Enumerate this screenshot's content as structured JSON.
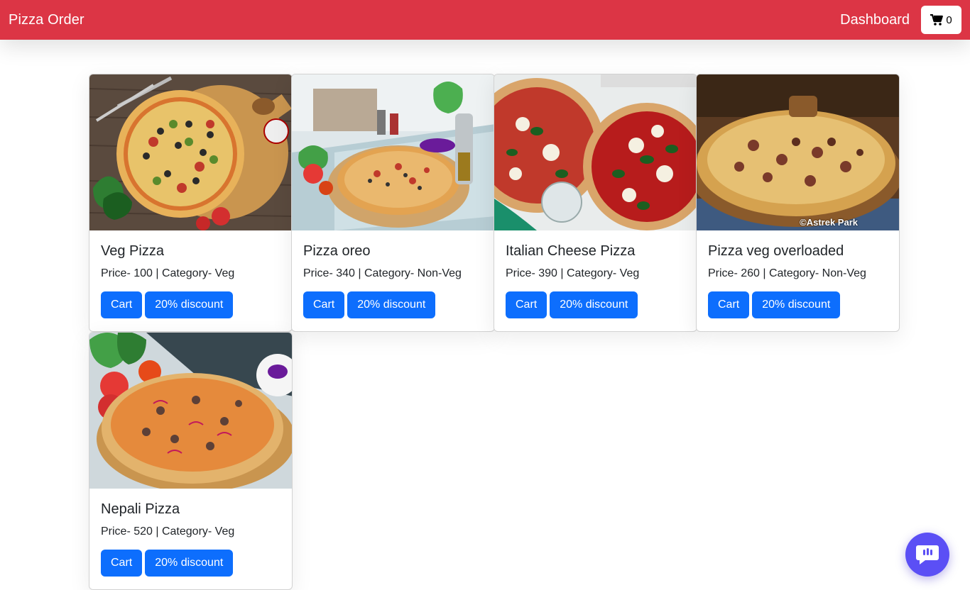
{
  "nav": {
    "brand": "Pizza Order",
    "dashboard": "Dashboard",
    "cart_count": "0",
    "cart_icon": "shopping-cart-icon",
    "bg_color": "#dc3545"
  },
  "products": [
    {
      "name": "Veg Pizza",
      "meta": "Price- 100 | Category- Veg",
      "cart_label": "Cart",
      "discount_label": "20% discount"
    },
    {
      "name": "Pizza oreo",
      "meta": "Price- 340 | Category- Non-Veg",
      "cart_label": "Cart",
      "discount_label": "20% discount"
    },
    {
      "name": "Italian Cheese Pizza",
      "meta": "Price- 390 | Category- Veg",
      "cart_label": "Cart",
      "discount_label": "20% discount"
    },
    {
      "name": "Pizza veg overloaded",
      "meta": "Price- 260 | Category- Non-Veg",
      "cart_label": "Cart",
      "discount_label": "20% discount",
      "watermark": "©Astrek Park"
    },
    {
      "name": "Nepali Pizza",
      "meta": "Price- 520 | Category- Veg",
      "cart_label": "Cart",
      "discount_label": "20% discount"
    }
  ],
  "colors": {
    "primary_button": "#0d6efd",
    "chat_button": "#5b4ff5"
  },
  "chat": {
    "icon": "chat-bubble-icon"
  }
}
